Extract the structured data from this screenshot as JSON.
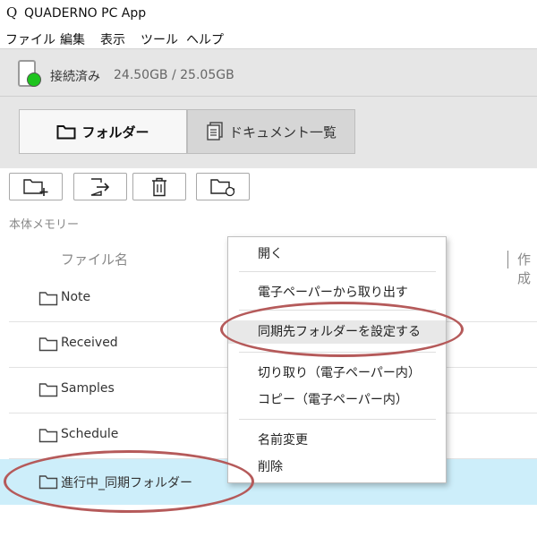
{
  "window": {
    "logo": "Q",
    "title": "QUADERNO PC App"
  },
  "menubar": [
    "ファイル",
    "編集",
    "表示",
    "ツール",
    "ヘルプ"
  ],
  "device": {
    "status": "接続済み",
    "storage": "24.50GB / 25.05GB",
    "status_color": "#1ec41e"
  },
  "tabs": [
    {
      "label": "フォルダー",
      "active": true
    },
    {
      "label": "ドキュメント一覧",
      "active": false
    }
  ],
  "toolbar": [
    "new-folder-icon",
    "export-icon",
    "trash-icon",
    "sync-folder-icon"
  ],
  "section_label": "本体メモリー",
  "columns": {
    "name": "ファイル名",
    "created": "作成"
  },
  "rows": [
    {
      "label": "Note"
    },
    {
      "label": "Received"
    },
    {
      "label": "Samples"
    },
    {
      "label": "Schedule"
    },
    {
      "label": "進行中_同期フォルダー",
      "selected": true
    }
  ],
  "context_menu": {
    "items": [
      "開く",
      "電子ペーパーから取り出す",
      "同期先フォルダーを設定する",
      "切り取り（電子ペーパー内）",
      "コピー（電子ペーパー内）",
      "名前変更",
      "削除"
    ],
    "highlighted": "同期先フォルダーを設定する"
  },
  "annotation_color": "#b55a5a"
}
